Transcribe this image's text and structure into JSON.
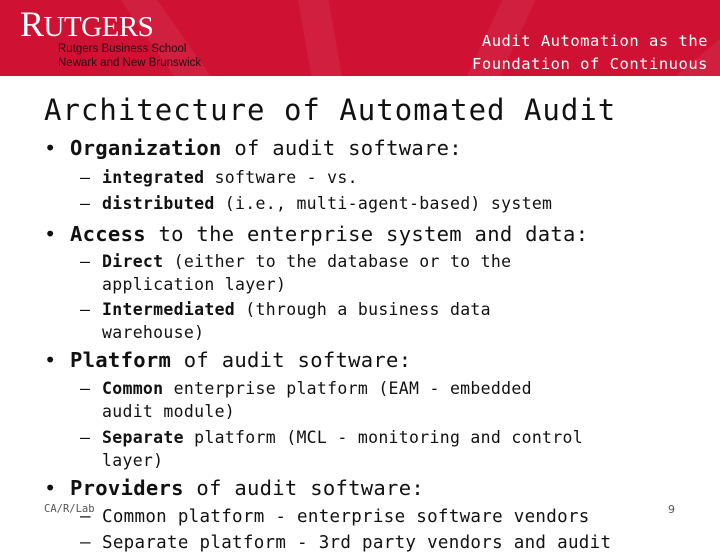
{
  "header": {
    "logo_text_first": "R",
    "logo_text_rest": "UTGERS",
    "school_line1": "Rutgers Business School",
    "school_line2": "Newark and New Brunswick",
    "deck_title_line1": "Audit Automation as the",
    "deck_title_line2": "Foundation of Continuous",
    "brand_color": "#cf1233"
  },
  "slide": {
    "title": "Architecture of Automated Audit",
    "bullets": [
      {
        "bold": "Organization",
        "rest": " of audit software:",
        "subs": [
          {
            "bold": "integrated",
            "rest": " software - vs.",
            "cont": ""
          },
          {
            "bold": "distributed",
            "rest": " (i.e., multi-agent-based) system",
            "cont": ""
          }
        ]
      },
      {
        "bold": "Access",
        "rest": " to the enterprise system and data:",
        "subs": [
          {
            "bold": "Direct",
            "rest": " (either to the database or to the",
            "cont": "application layer)"
          },
          {
            "bold": "Intermediated",
            "rest": " (through a business data",
            "cont": "warehouse)"
          }
        ]
      },
      {
        "bold": "Platform",
        "rest": " of audit software:",
        "subs": [
          {
            "bold": "Common",
            "rest": " enterprise platform (EAM - embedded",
            "cont": "audit module)"
          },
          {
            "bold": "Separate",
            "rest": " platform (MCL - monitoring and control",
            "cont": "layer)"
          }
        ]
      },
      {
        "bold": "Providers",
        "rest": " of audit software:",
        "subs": [
          {
            "bold": "",
            "rest": "Common platform - enterprise software vendors",
            "cont": ""
          },
          {
            "bold": "",
            "rest": "Separate platform - 3rd party vendors and audit",
            "cont": ""
          }
        ]
      }
    ]
  },
  "footer": {
    "left": "CA/R/Lab",
    "page_number": "9"
  }
}
